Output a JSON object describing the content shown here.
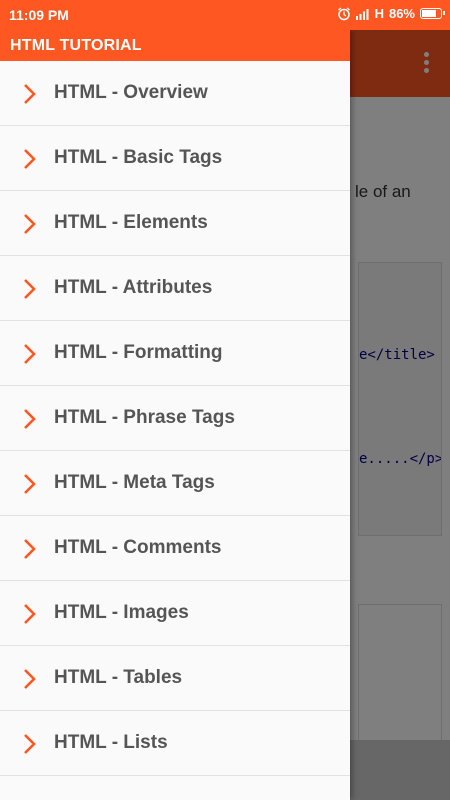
{
  "status_bar": {
    "time": "11:09 PM",
    "network": "H",
    "battery_percent": "86%",
    "battery_level": 0.86,
    "icons": [
      "alarm-icon",
      "signal-icon",
      "battery-icon"
    ]
  },
  "colors": {
    "accent": "#ff5722",
    "page_toolbar_dimmed": "#7a2a10",
    "chevron": "#ff5722",
    "item_text": "#555555"
  },
  "drawer": {
    "title": "HTML TUTORIAL",
    "items": [
      {
        "label": "HTML - Overview"
      },
      {
        "label": "HTML - Basic Tags"
      },
      {
        "label": "HTML - Elements"
      },
      {
        "label": "HTML - Attributes"
      },
      {
        "label": "HTML - Formatting"
      },
      {
        "label": "HTML - Phrase Tags"
      },
      {
        "label": "HTML - Meta Tags"
      },
      {
        "label": "HTML - Comments"
      },
      {
        "label": "HTML - Images"
      },
      {
        "label": "HTML - Tables"
      },
      {
        "label": "HTML - Lists"
      }
    ]
  },
  "background_page": {
    "text_fragment": "le of an",
    "code_line_1": "e</title>",
    "code_line_2": "e.....</p>"
  }
}
